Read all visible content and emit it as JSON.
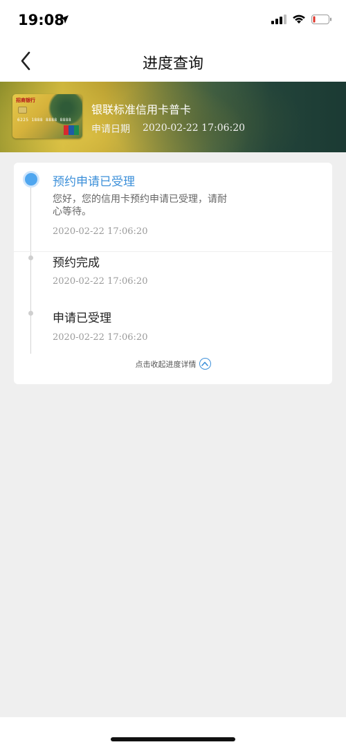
{
  "status_bar": {
    "time": "19:08",
    "icons": [
      "location-arrow-icon",
      "cellular-signal-icon",
      "wifi-icon",
      "battery-low-icon"
    ]
  },
  "nav": {
    "title": "进度查询",
    "back_icon": "chevron-left-icon"
  },
  "card": {
    "name": "银联标准信用卡普卡",
    "date_label": "申请日期",
    "date": "2020-02-22 17:06:20",
    "thumb_bank": "招商银行",
    "thumb_number": "6225 1888 8888 8888"
  },
  "progress": {
    "steps": [
      {
        "title": "预约申请已受理",
        "desc": "您好，您的信用卡预约申请已受理，请耐心等待。",
        "time": "2020-02-22 17:06:20",
        "active": true
      },
      {
        "title": "预约完成",
        "time": "2020-02-22 17:06:20",
        "active": false
      },
      {
        "title": "申请已受理",
        "time": "2020-02-22 17:06:20",
        "active": false
      }
    ],
    "collapse_label": "点击收起进度详情",
    "collapse_icon": "chevron-up-circle-icon"
  },
  "colors": {
    "accent": "#3b8fd9",
    "active_dot": "#4fa6ef",
    "background": "#efefef"
  }
}
